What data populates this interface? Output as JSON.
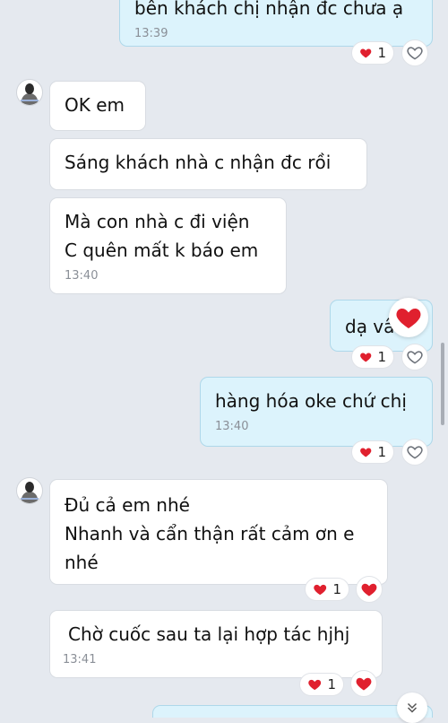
{
  "colors": {
    "background": "#e5e9ef",
    "incoming_bubble": "#ffffff",
    "outgoing_bubble": "#dcf3fc",
    "heart": "#e0202e"
  },
  "messages": [
    {
      "direction": "out",
      "text": "bên khách chị nhận đc chưa ạ",
      "time": "13:39",
      "reaction_count": "1"
    },
    {
      "direction": "in",
      "text": "OK em"
    },
    {
      "direction": "in",
      "text": "Sáng khách nhà c nhận đc rồi"
    },
    {
      "direction": "in",
      "text": "Mà con nhà c đi viện\nC quên mất k báo em",
      "time": "13:40"
    },
    {
      "direction": "out",
      "text": "dạ vâ",
      "reaction_count": "1"
    },
    {
      "direction": "out",
      "text": "hàng hóa oke chứ chị",
      "time": "13:40",
      "reaction_count": "1"
    },
    {
      "direction": "in",
      "text": "Đủ cả em nhé\nNhanh và cẩn thận rất cảm ơn e\nnhé",
      "reaction_count": "1"
    },
    {
      "direction": "in",
      "text": "Chờ cuốc sau ta lại hợp tác hjhj",
      "time": "13:41",
      "reaction_count": "1"
    }
  ],
  "icons": {
    "reaction_heart": "heart-icon",
    "react_button": "heart-outline-icon",
    "scroll_down": "double-chevron-down-icon",
    "avatar": "user-avatar"
  }
}
